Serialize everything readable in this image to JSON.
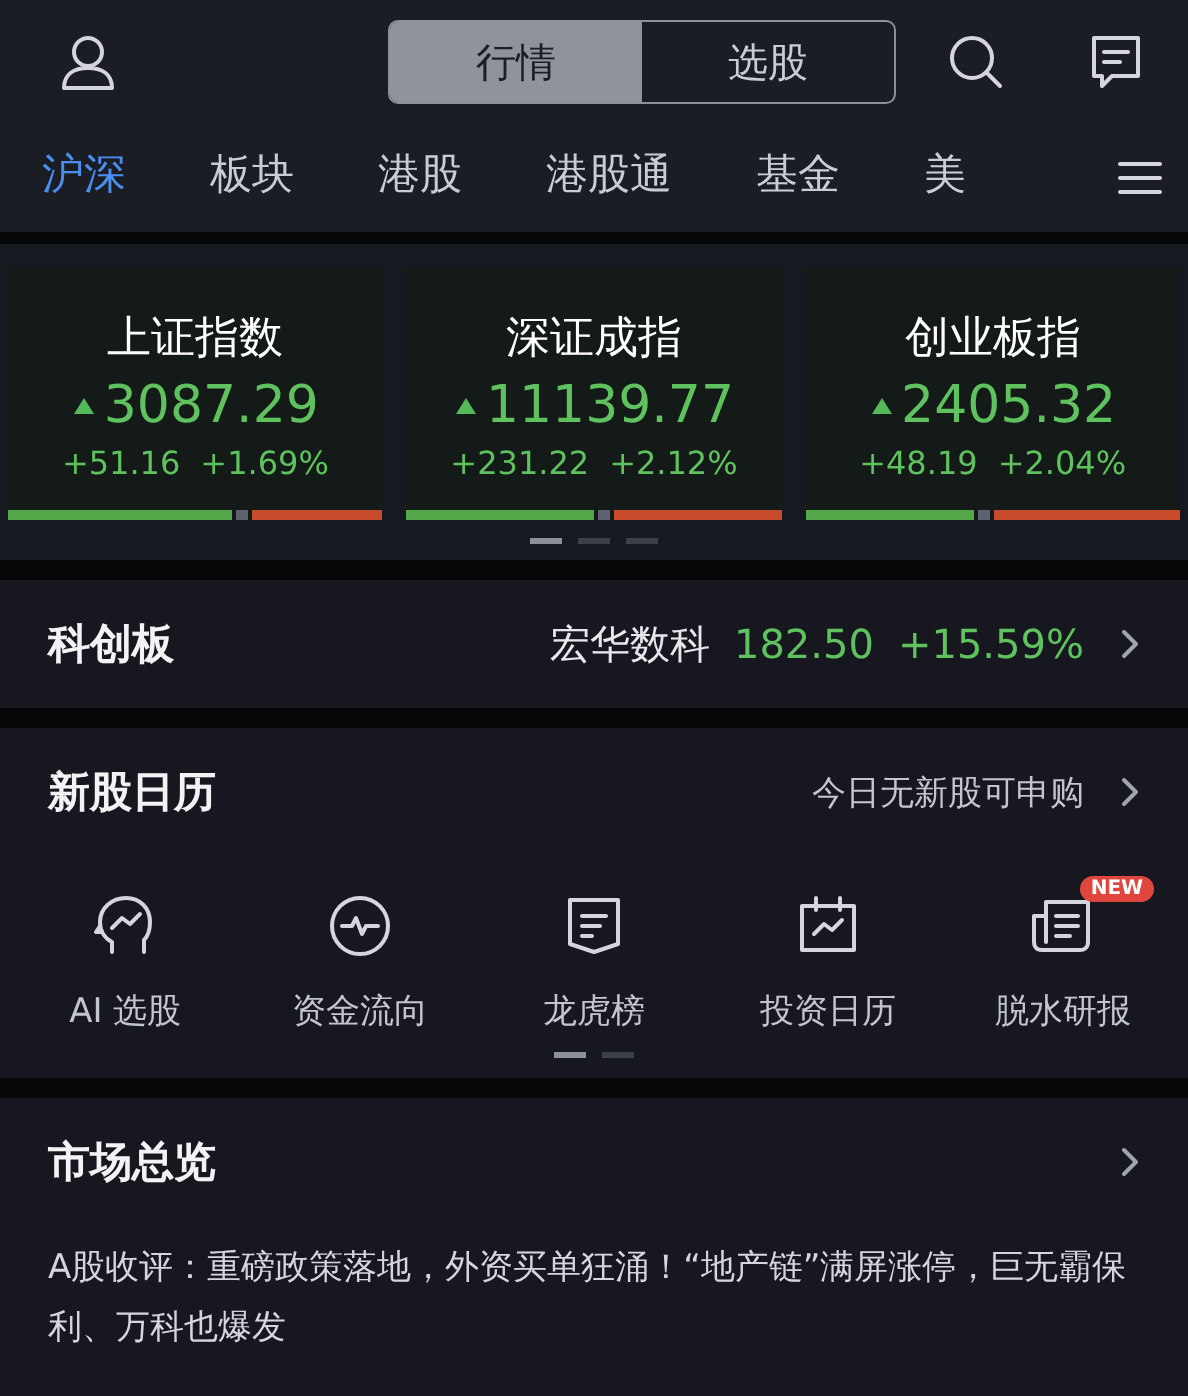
{
  "segments": [
    {
      "label": "行情",
      "selected": true
    },
    {
      "label": "选股",
      "selected": false
    }
  ],
  "tabs": [
    {
      "label": "沪深",
      "selected": true
    },
    {
      "label": "板块",
      "selected": false
    },
    {
      "label": "港股",
      "selected": false
    },
    {
      "label": "港股通",
      "selected": false
    },
    {
      "label": "基金",
      "selected": false
    },
    {
      "label": "美",
      "selected": false
    }
  ],
  "indices": [
    {
      "name": "上证指数",
      "value": "3087.29",
      "change": "+51.16",
      "percent": "+1.69%",
      "level": 0.6
    },
    {
      "name": "深证成指",
      "value": "11139.77",
      "change": "+231.22",
      "percent": "+2.12%",
      "level": 0.5
    },
    {
      "name": "创业板指",
      "value": "2405.32",
      "change": "+48.19",
      "percent": "+2.04%",
      "level": 0.45
    }
  ],
  "index_pages": [
    {
      "selected": true
    },
    {
      "selected": false
    },
    {
      "selected": false
    }
  ],
  "star_market": {
    "title": "科创板",
    "stock": "宏华数科",
    "price": "182.50",
    "change": "+15.59%"
  },
  "ipo_calendar": {
    "title": "新股日历",
    "note": "今日无新股可申购"
  },
  "shortcuts": [
    {
      "kind": "ai",
      "label": "AI 选股"
    },
    {
      "kind": "flow",
      "label": "资金流向"
    },
    {
      "kind": "board",
      "label": "龙虎榜"
    },
    {
      "kind": "calendar",
      "label": "投资日历"
    },
    {
      "kind": "report",
      "label": "脱水研报",
      "badge": "NEW"
    }
  ],
  "shortcut_pages": [
    {
      "selected": true
    },
    {
      "selected": false
    }
  ],
  "market_overview": {
    "title": "市场总览",
    "headline": "A股收评：重磅政策落地，外资买单狂涌！“地产链”满屏涨停，巨无霸保利、万科也爆发"
  }
}
